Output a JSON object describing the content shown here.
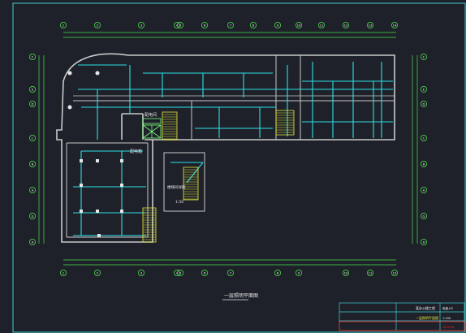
{
  "colors": {
    "background": "#1e2129",
    "frame": "#3fd0d6",
    "walls": "#c9c9c9",
    "wiring": "#2ce0e6",
    "axis": "#4cdd4c",
    "stairs": "#e8e840",
    "equipment": "#7cff7c",
    "title_red": "#ff2020"
  },
  "grid_top": [
    "1",
    "2",
    "3",
    "4",
    "5",
    "6",
    "7",
    "8",
    "9",
    "10",
    "11",
    "12",
    "13",
    "14"
  ],
  "grid_bottom": [
    "1",
    "2",
    "3",
    "4",
    "5",
    "6",
    "7",
    "8",
    "9",
    "10",
    "11",
    "12"
  ],
  "grid_left": [
    "F",
    "E",
    "D",
    "C",
    "B",
    "A",
    "G",
    "H"
  ],
  "grid_right": [
    "F",
    "E",
    "D",
    "C",
    "B",
    "A",
    "G",
    "H"
  ],
  "room_labels": [
    "配电间",
    "配电箱"
  ],
  "stair_detail": {
    "title": "楼梯间详图",
    "scale": "1:50"
  },
  "plan_title": "一层照明平面图",
  "title_block": {
    "project": "某办公楼工程",
    "drawing": "一层照明平面图",
    "drawing_no": "电施-03",
    "scale": "1:100",
    "date": "2015.06"
  }
}
